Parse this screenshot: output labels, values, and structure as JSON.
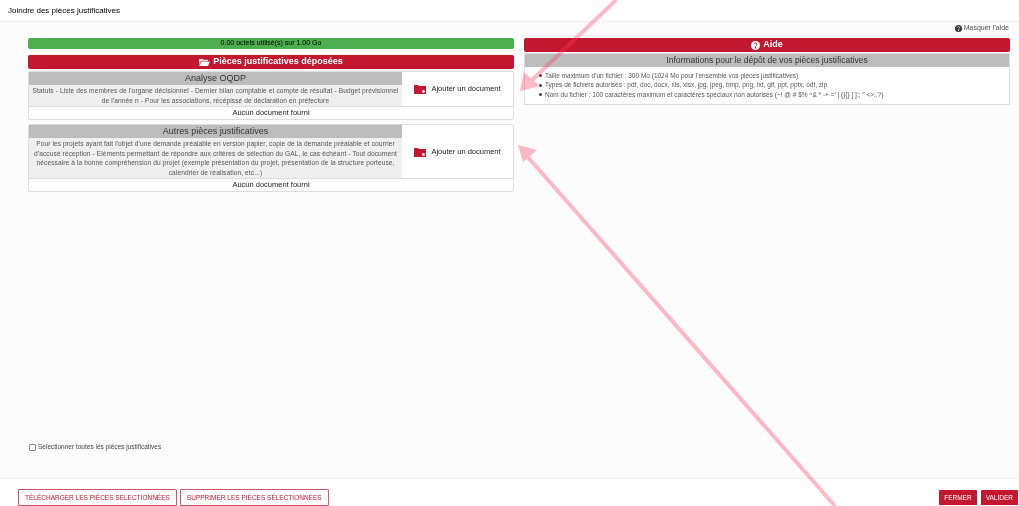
{
  "window": {
    "title": "Joindre des pièces justificatives"
  },
  "storage": {
    "label": "0.00 octets utilisé(s) sur 1.00 Go"
  },
  "documents": {
    "title": "Pièces justificatives déposées",
    "sections": [
      {
        "title": "Analyse OQDP",
        "description": "Statuts - Liste des membres de l'organe décisionnel - Dernier bilan comptable et compte de résultat - Budget prévisionnel de l'année n - Pour les associations, récépissé de déclaration en préfecture",
        "action": "Ajouter un document",
        "status": "Aucun document fourni"
      },
      {
        "title": "Autres pièces justificatives",
        "description": "Pour les projets ayant fait l'objet d'une demande préalable en version papier, copie de la demande préalable et courrier d'accusé réception - Eléments permettant de répondre aux critères de sélection du GAL, le cas échéant - Tout document nécessaire à la bonne compréhension du projet (exemple présentation du projet, présentation de la structure porteuse, calendrier de réalisation, etc...)",
        "action": "Ajouter un document",
        "status": "Aucun document fourni"
      }
    ]
  },
  "help": {
    "toggle": "Masquer l'aide",
    "title": "Aide",
    "subtitle": "Informations pour le dépôt de vos pièces justificatives",
    "items": [
      "Taille maximum d'un fichier : 300 Mo (1024 Mo pour l'ensemble vos pièces justificatives)",
      "Types de fichiers autorisés : pdf, doc, docx, xls, xlsx, jpg, jpeg, bmp, png, txt, gif, ppt, pptx, odt, zip",
      "Nom du fichier : 100 caractères maximum et caractères spéciaux non autorisés (~! @ # $% ^& * -+ =' | (){} [ ]:; \" <>,.?)"
    ]
  },
  "select_all": {
    "label": "Sélectionner toutes les pièces justificatives",
    "checked": false
  },
  "footer": {
    "left_buttons": [
      "TÉLÉCHARGER LES PIÈCES SÉLECTIONNÉES",
      "SUPPRIMER LES PIÈCES SÉLECTIONNÉES"
    ],
    "right_buttons": [
      "FERMER",
      "VALIDER"
    ]
  }
}
